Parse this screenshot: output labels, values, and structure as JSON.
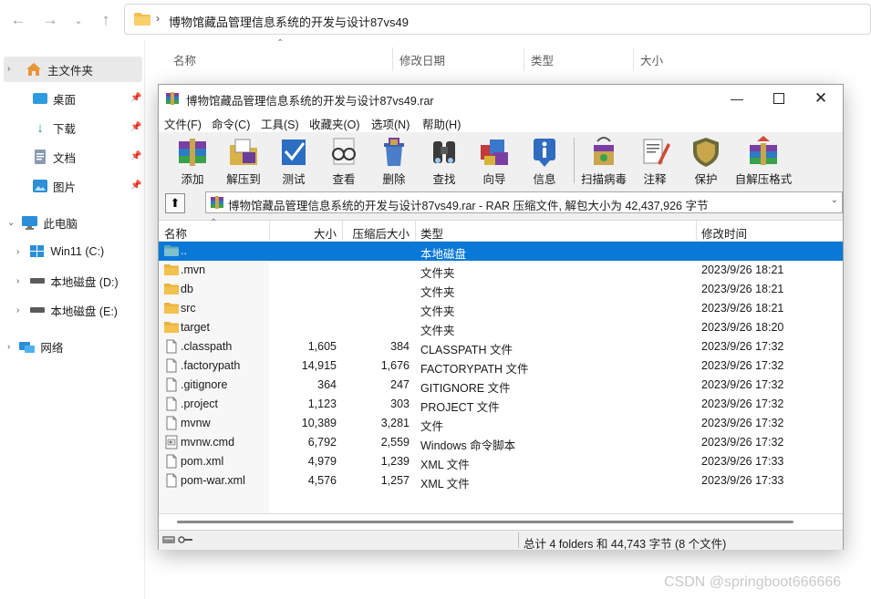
{
  "explorer": {
    "address": "博物馆藏品管理信息系统的开发与设计87vs49",
    "sidebar": {
      "home": "主文件夹",
      "desktop": "桌面",
      "downloads": "下载",
      "documents": "文档",
      "pictures": "图片",
      "thispc": "此电脑",
      "drive_c": "Win11 (C:)",
      "drive_d": "本地磁盘 (D:)",
      "drive_e": "本地磁盘 (E:)",
      "network": "网络"
    },
    "columns": {
      "name": "名称",
      "modified": "修改日期",
      "type": "类型",
      "size": "大小"
    }
  },
  "rar": {
    "title": "博物馆藏品管理信息系统的开发与设计87vs49.rar",
    "menu": [
      "文件(F)",
      "命令(C)",
      "工具(S)",
      "收藏夹(O)",
      "选项(N)",
      "帮助(H)"
    ],
    "toolbar": [
      "添加",
      "解压到",
      "测试",
      "查看",
      "删除",
      "查找",
      "向导",
      "信息",
      "扫描病毒",
      "注释",
      "保护",
      "自解压格式"
    ],
    "path": "博物馆藏品管理信息系统的开发与设计87vs49.rar - RAR 压缩文件, 解包大小为 42,437,926 字节",
    "columns": {
      "name": "名称",
      "size": "大小",
      "packed": "压缩后大小",
      "type": "类型",
      "modified": "修改时间"
    },
    "files": [
      {
        "name": "..",
        "size": "",
        "packed": "",
        "type": "本地磁盘",
        "modified": "",
        "kind": "parent"
      },
      {
        "name": ".mvn",
        "size": "",
        "packed": "",
        "type": "文件夹",
        "modified": "2023/9/26 18:21",
        "kind": "folder"
      },
      {
        "name": "db",
        "size": "",
        "packed": "",
        "type": "文件夹",
        "modified": "2023/9/26 18:21",
        "kind": "folder"
      },
      {
        "name": "src",
        "size": "",
        "packed": "",
        "type": "文件夹",
        "modified": "2023/9/26 18:21",
        "kind": "folder"
      },
      {
        "name": "target",
        "size": "",
        "packed": "",
        "type": "文件夹",
        "modified": "2023/9/26 18:20",
        "kind": "folder"
      },
      {
        "name": ".classpath",
        "size": "1,605",
        "packed": "384",
        "type": "CLASSPATH 文件",
        "modified": "2023/9/26 17:32",
        "kind": "file"
      },
      {
        "name": ".factorypath",
        "size": "14,915",
        "packed": "1,676",
        "type": "FACTORYPATH 文件",
        "modified": "2023/9/26 17:32",
        "kind": "file"
      },
      {
        "name": ".gitignore",
        "size": "364",
        "packed": "247",
        "type": "GITIGNORE 文件",
        "modified": "2023/9/26 17:32",
        "kind": "file"
      },
      {
        "name": ".project",
        "size": "1,123",
        "packed": "303",
        "type": "PROJECT 文件",
        "modified": "2023/9/26 17:32",
        "kind": "file"
      },
      {
        "name": "mvnw",
        "size": "10,389",
        "packed": "3,281",
        "type": "文件",
        "modified": "2023/9/26 17:32",
        "kind": "file"
      },
      {
        "name": "mvnw.cmd",
        "size": "6,792",
        "packed": "2,559",
        "type": "Windows 命令脚本",
        "modified": "2023/9/26 17:32",
        "kind": "cmd"
      },
      {
        "name": "pom.xml",
        "size": "4,979",
        "packed": "1,239",
        "type": "XML 文件",
        "modified": "2023/9/26 17:33",
        "kind": "file"
      },
      {
        "name": "pom-war.xml",
        "size": "4,576",
        "packed": "1,257",
        "type": "XML 文件",
        "modified": "2023/9/26 17:33",
        "kind": "file"
      }
    ],
    "status": "总计 4 folders 和 44,743 字节 (8 个文件)"
  },
  "watermark": "CSDN @springboot666666",
  "colors": {
    "selection": "#0a78d7",
    "folder": "#f2c14e"
  }
}
